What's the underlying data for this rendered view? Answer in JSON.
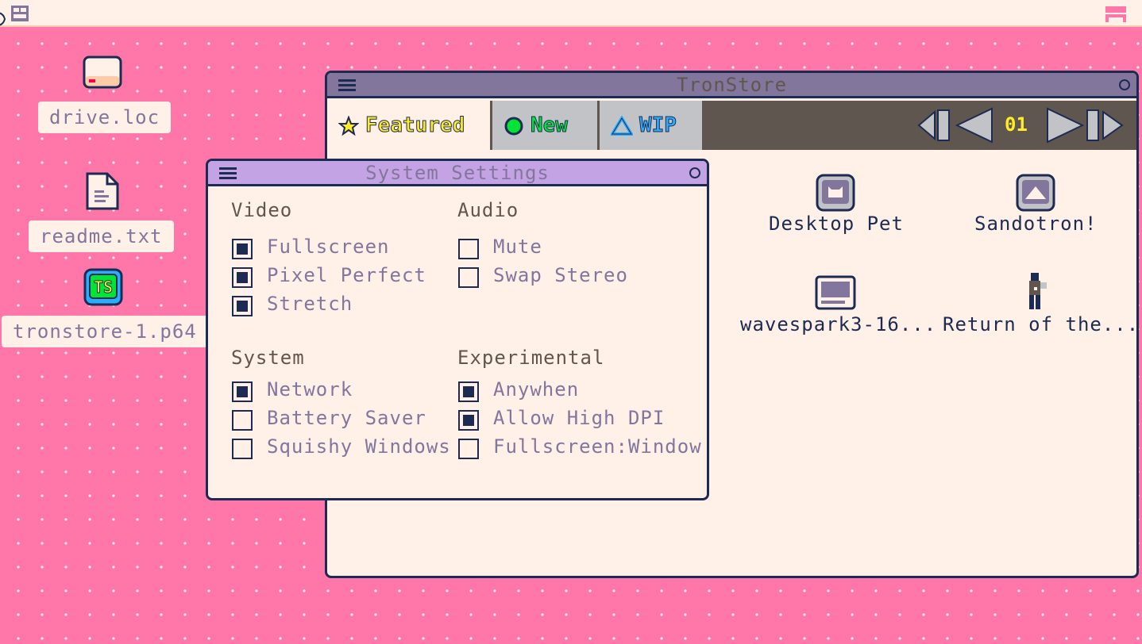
{
  "topbar": {
    "menu_icon": "app-menu-icon",
    "tray_icon": "workspace-icon"
  },
  "desktop": {
    "icons": [
      {
        "label": "drive.loc",
        "icon": "drive-icon"
      },
      {
        "label": "readme.txt",
        "icon": "text-file-icon"
      },
      {
        "label": "tronstore-1.p64",
        "icon": "tronstore-cart-icon",
        "glyph_text": "TS"
      }
    ]
  },
  "tronstore": {
    "title": "TronStore",
    "tabs": [
      {
        "label": "Featured",
        "icon": "star-icon",
        "color": "#ffec27"
      },
      {
        "label": "New",
        "icon": "circle-icon",
        "color": "#00e436"
      },
      {
        "label": "WIP",
        "icon": "triangle-icon",
        "color": "#29adff"
      }
    ],
    "pager": {
      "page": "01"
    },
    "apps": [
      {
        "name": "Desktop Pet",
        "icon": "cat-cartridge-icon"
      },
      {
        "name": "Sandotron!",
        "icon": "mountain-cartridge-icon"
      },
      {
        "name": "wavespark3-16...",
        "icon": "monitor-icon"
      },
      {
        "name": "Return of the...",
        "icon": "character-sprite-icon"
      }
    ]
  },
  "settings": {
    "title": "System Settings",
    "sections": {
      "video": {
        "title": "Video",
        "options": [
          {
            "label": "Fullscreen",
            "checked": true
          },
          {
            "label": "Pixel Perfect",
            "checked": true
          },
          {
            "label": "Stretch",
            "checked": true
          }
        ]
      },
      "audio": {
        "title": "Audio",
        "options": [
          {
            "label": "Mute",
            "checked": false
          },
          {
            "label": "Swap Stereo",
            "checked": false
          }
        ]
      },
      "system": {
        "title": "System",
        "options": [
          {
            "label": "Network",
            "checked": true
          },
          {
            "label": "Battery Saver",
            "checked": false
          },
          {
            "label": "Squishy Windows",
            "checked": false
          }
        ]
      },
      "experimental": {
        "title": "Experimental",
        "options": [
          {
            "label": "Anywhen",
            "checked": true
          },
          {
            "label": "Allow High DPI",
            "checked": true
          },
          {
            "label": "Fullscreen:Window",
            "checked": false
          }
        ]
      }
    }
  },
  "colors": {
    "desktop": "#ff77a8",
    "window_bg": "#fff1e8",
    "ink": "#1d2b53"
  }
}
